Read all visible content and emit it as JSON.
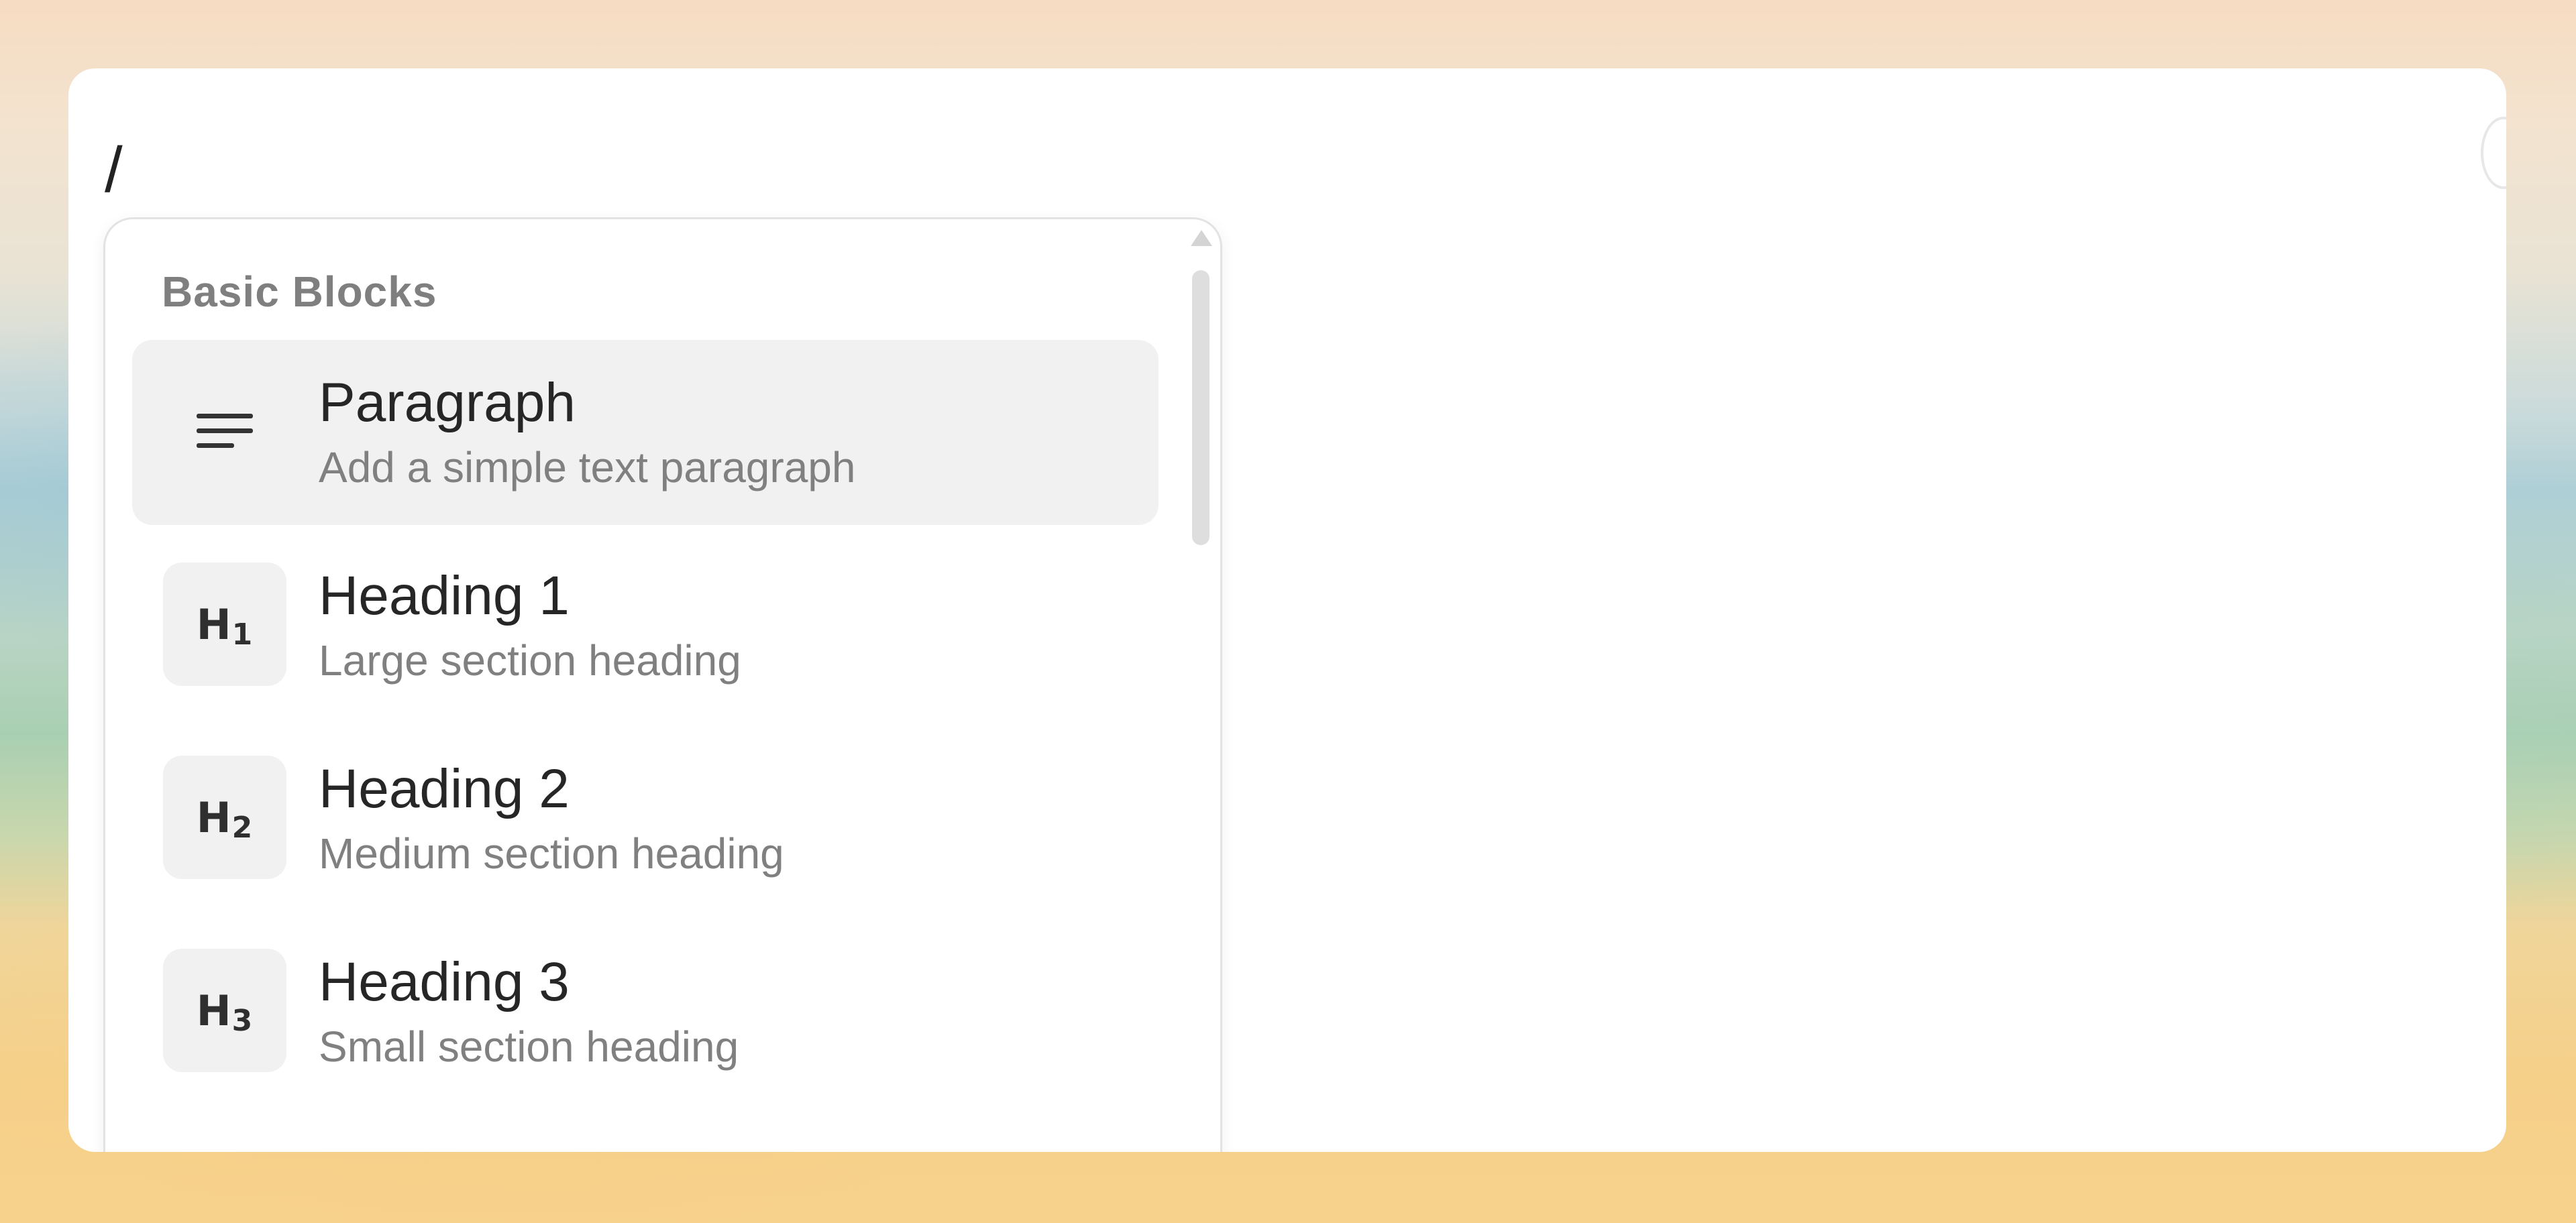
{
  "editor": {
    "content": "/"
  },
  "slash_menu": {
    "group_label": "Basic Blocks",
    "items": [
      {
        "icon": "paragraph-lines-icon",
        "title": "Paragraph",
        "description": "Add a simple text paragraph",
        "selected": true
      },
      {
        "icon": "heading-1-icon",
        "icon_text": "H",
        "icon_sub": "1",
        "title": "Heading 1",
        "description": "Large section heading"
      },
      {
        "icon": "heading-2-icon",
        "icon_text": "H",
        "icon_sub": "2",
        "title": "Heading 2",
        "description": "Medium section heading"
      },
      {
        "icon": "heading-3-icon",
        "icon_text": "H",
        "icon_sub": "3",
        "title": "Heading 3",
        "description": "Small section heading"
      }
    ]
  },
  "colors": {
    "selected_item_bg": "#f1f1f1",
    "title_text": "#262626",
    "description_text": "#808080",
    "group_label_text": "#7f7f7f"
  }
}
